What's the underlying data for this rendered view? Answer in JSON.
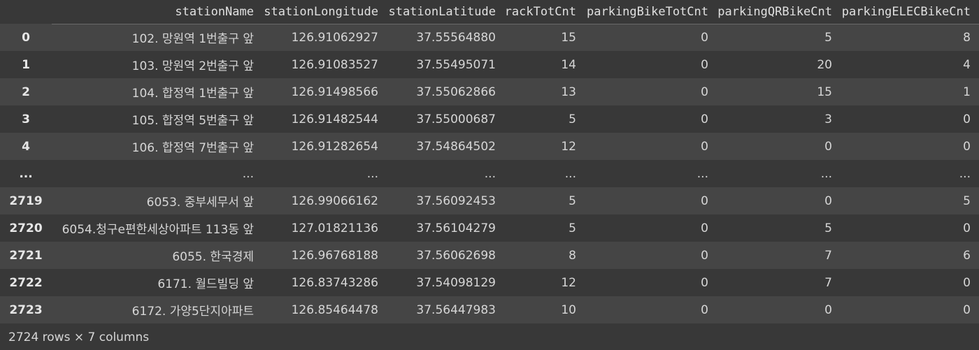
{
  "columns": [
    "stationName",
    "stationLongitude",
    "stationLatitude",
    "rackTotCnt",
    "parkingBikeTotCnt",
    "parkingQRBikeCnt",
    "parkingELECBikeCnt"
  ],
  "rows": [
    {
      "index": "0",
      "cells": [
        "102. 망원역 1번출구 앞",
        "126.91062927",
        "37.55564880",
        "15",
        "0",
        "5",
        "8"
      ]
    },
    {
      "index": "1",
      "cells": [
        "103. 망원역 2번출구 앞",
        "126.91083527",
        "37.55495071",
        "14",
        "0",
        "20",
        "4"
      ]
    },
    {
      "index": "2",
      "cells": [
        "104. 합정역 1번출구 앞",
        "126.91498566",
        "37.55062866",
        "13",
        "0",
        "15",
        "1"
      ]
    },
    {
      "index": "3",
      "cells": [
        "105. 합정역 5번출구 앞",
        "126.91482544",
        "37.55000687",
        "5",
        "0",
        "3",
        "0"
      ]
    },
    {
      "index": "4",
      "cells": [
        "106. 합정역 7번출구 앞",
        "126.91282654",
        "37.54864502",
        "12",
        "0",
        "0",
        "0"
      ]
    },
    {
      "index": "...",
      "cells": [
        "...",
        "...",
        "...",
        "...",
        "...",
        "...",
        "..."
      ]
    },
    {
      "index": "2719",
      "cells": [
        "6053. 중부세무서 앞",
        "126.99066162",
        "37.56092453",
        "5",
        "0",
        "0",
        "5"
      ]
    },
    {
      "index": "2720",
      "cells": [
        "6054.청구e편한세상아파트 113동 앞",
        "127.01821136",
        "37.56104279",
        "5",
        "0",
        "5",
        "0"
      ]
    },
    {
      "index": "2721",
      "cells": [
        "6055. 한국경제",
        "126.96768188",
        "37.56062698",
        "8",
        "0",
        "7",
        "6"
      ]
    },
    {
      "index": "2722",
      "cells": [
        "6171. 월드빌딩 앞",
        "126.83743286",
        "37.54098129",
        "12",
        "0",
        "7",
        "0"
      ]
    },
    {
      "index": "2723",
      "cells": [
        "6172. 가양5단지아파트",
        "126.85464478",
        "37.56447983",
        "10",
        "0",
        "0",
        "0"
      ]
    }
  ],
  "footer": "2724 rows × 7 columns"
}
